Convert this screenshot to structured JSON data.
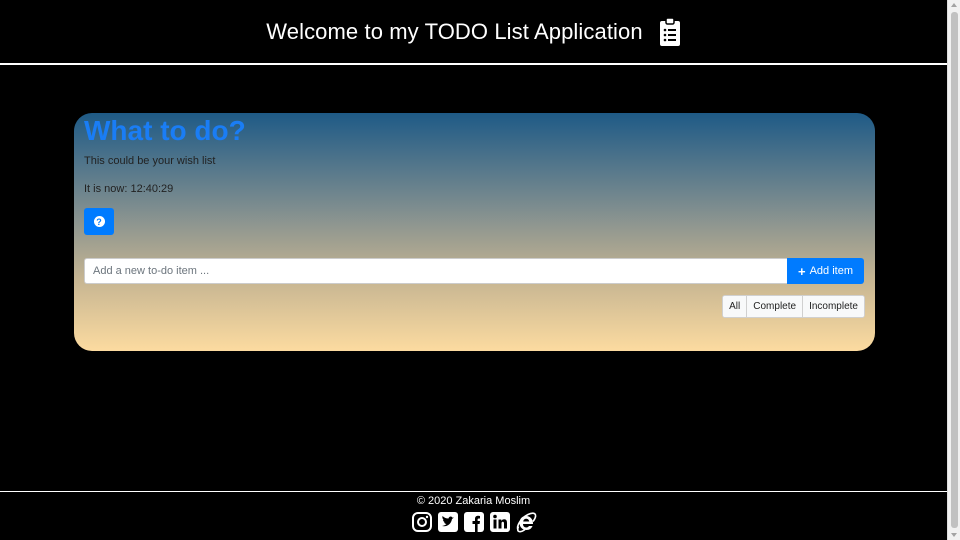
{
  "header": {
    "title": "Welcome to my TODO List Application",
    "icon": "clipboard-list-icon"
  },
  "card": {
    "heading": "What to do?",
    "subtitle": "This could be your wish list",
    "clock_text": "It is now: 12:40:29",
    "help_icon": "question-circle-icon",
    "input_placeholder": "Add a new to-do item ...",
    "input_value": "",
    "add_button_label": "Add item",
    "filters": [
      "All",
      "Complete",
      "Incomplete"
    ],
    "colors": {
      "accent": "#007bff",
      "heading": "#1a7df5",
      "gradient_top": "#1e5a86",
      "gradient_bottom": "#fcdba0"
    }
  },
  "footer": {
    "copyright": "© 2020 Zakaria Moslim",
    "social_icons": [
      "instagram-icon",
      "twitter-icon",
      "facebook-icon",
      "linkedin-icon",
      "internet-explorer-icon"
    ]
  }
}
